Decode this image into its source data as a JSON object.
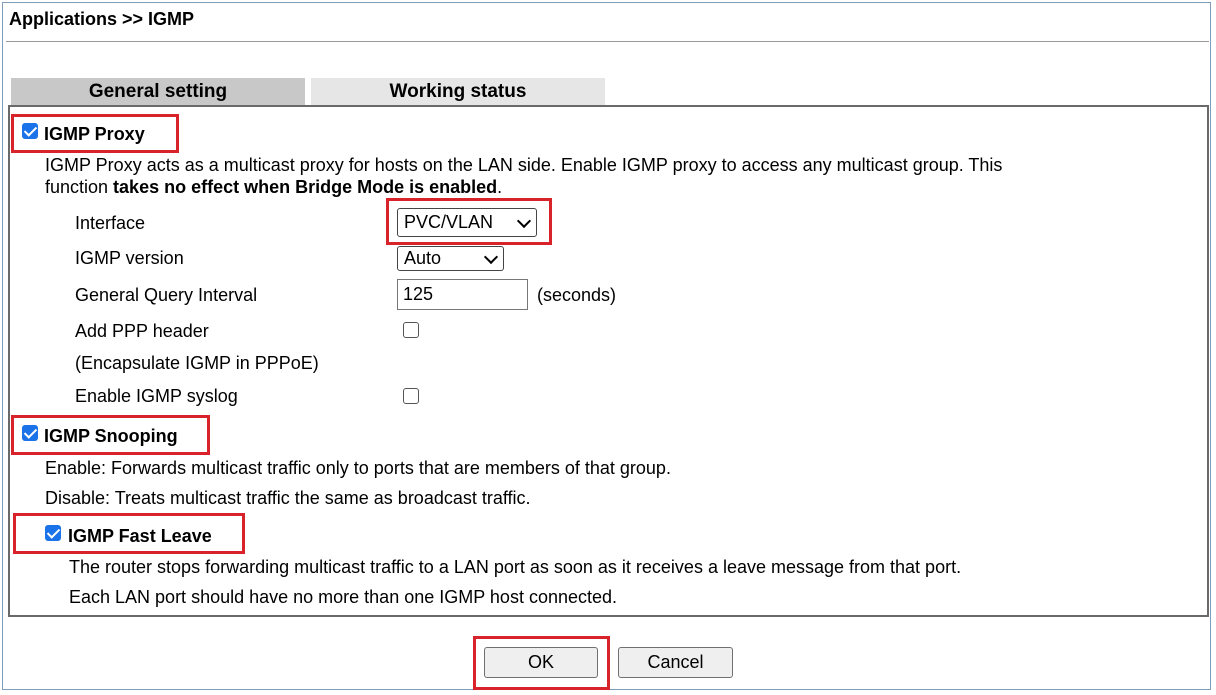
{
  "header": {
    "breadcrumb": "Applications >> IGMP"
  },
  "tabs": [
    {
      "label": "General setting",
      "active": true
    },
    {
      "label": "Working status",
      "active": false
    }
  ],
  "igmp_proxy": {
    "label": "IGMP Proxy",
    "checked": true,
    "description_line1": "IGMP Proxy acts as a multicast proxy for hosts on the LAN side. Enable IGMP proxy to access any multicast group. This",
    "description_line2_prefix": "function ",
    "description_line2_bold": "takes no effect when Bridge Mode is enabled",
    "description_line2_suffix": ".",
    "interface_label": "Interface",
    "interface_value": "PVC/VLAN",
    "version_label": "IGMP version",
    "version_value": "Auto",
    "query_interval_label": "General Query Interval",
    "query_interval_value": "125",
    "query_interval_unit": "(seconds)",
    "ppp_header_label": "Add PPP header",
    "ppp_header_note": "(Encapsulate IGMP in PPPoE)",
    "ppp_header_checked": false,
    "syslog_label": "Enable IGMP syslog",
    "syslog_checked": false
  },
  "igmp_snooping": {
    "label": "IGMP Snooping",
    "checked": true,
    "enable_text": "Enable: Forwards multicast traffic only to ports that are members of that group.",
    "disable_text": "Disable: Treats multicast traffic the same as broadcast traffic."
  },
  "igmp_fast_leave": {
    "label": "IGMP Fast Leave",
    "checked": true,
    "text_line1": "The router stops forwarding multicast traffic to a LAN port as soon as it receives a leave message from that port.",
    "text_line2": "Each LAN port should have no more than one IGMP host connected."
  },
  "buttons": {
    "ok": "OK",
    "cancel": "Cancel"
  },
  "colors": {
    "highlight": "#d9232a",
    "checkbox_accent": "#1a73e8",
    "active_tab": "#c8c8c8",
    "inactive_tab": "#e6e6e6"
  }
}
